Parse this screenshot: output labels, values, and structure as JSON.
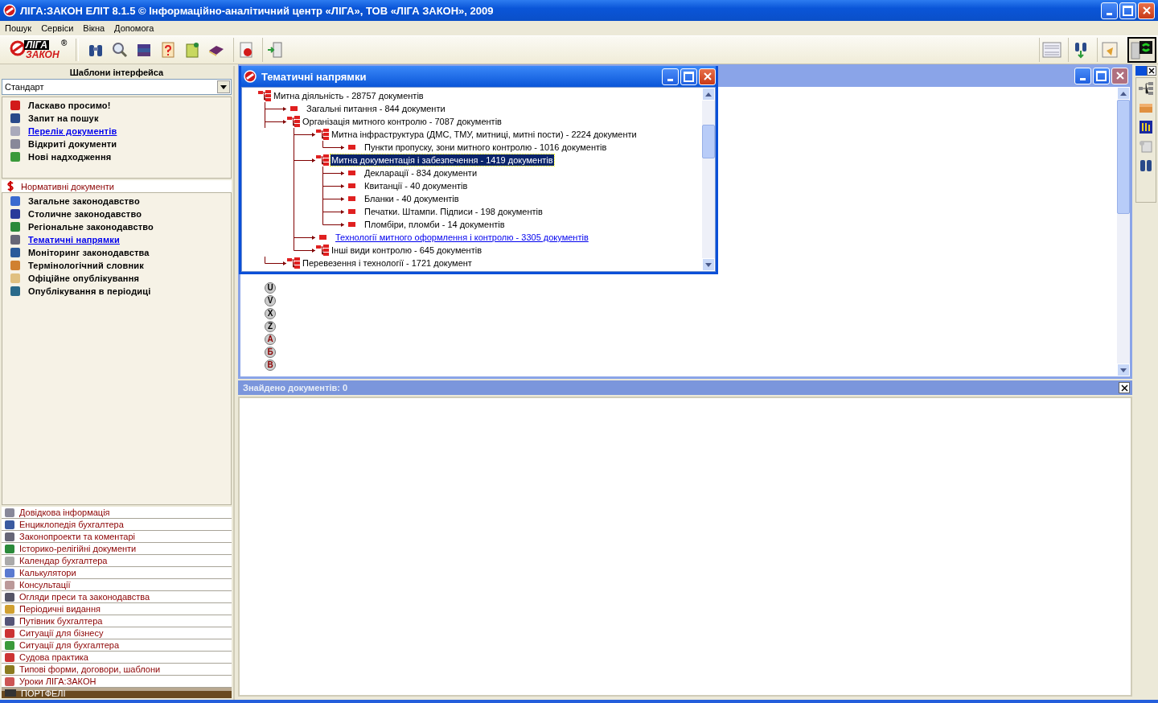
{
  "window": {
    "title": "ЛІГА:ЗАКОН ЕЛІТ 8.1.5 © Інформаційно-аналітичний центр «ЛІГА», ТОВ «ЛІГА ЗАКОН», 2009"
  },
  "menu": [
    "Пошук",
    "Сервіси",
    "Вікна",
    "Допомога"
  ],
  "logo": {
    "line_1": "ЛІГА",
    "line_2": "ЗАКОН",
    "mark": "®"
  },
  "sidebar": {
    "title": "Шаблони інтерфейса",
    "template": "Стандарт",
    "quick_items": [
      {
        "label": "Ласкаво просимо!",
        "link": false
      },
      {
        "label": "Запит на пошук",
        "link": false
      },
      {
        "label": "Перелік документів",
        "link": true
      },
      {
        "label": "Відкриті документи",
        "link": false
      },
      {
        "label": "Нові надходження",
        "link": false
      }
    ],
    "section": {
      "title": "Нормативні документи",
      "items": [
        {
          "label": "Загальне законодавство",
          "link": false
        },
        {
          "label": "Столичне законодавство",
          "link": false
        },
        {
          "label": "Регіональне законодавство",
          "link": false
        },
        {
          "label": "Тематичні напрямки",
          "link": true
        },
        {
          "label": "Моніторинг законодавства",
          "link": false
        },
        {
          "label": "Термінологічний словник",
          "link": false
        },
        {
          "label": "Офіційне опублікування",
          "link": false
        },
        {
          "label": "Опублікування в періодиці",
          "link": false
        }
      ]
    },
    "databases": [
      "Довідкова інформація",
      "Енциклопедія бухгалтера",
      "Законопроекти та коментарі",
      "Історико-релігійні документи",
      "Календар бухгалтера",
      "Калькулятори",
      "Консультації",
      "Огляди преси та законодавства",
      "Періодичні видання",
      "Путівник бухгалтера",
      "Ситуації для бізнесу",
      "Ситуації для бухгалтера",
      "Судова практика",
      "Типові форми, договори, шаблони",
      "Уроки ЛІГА:ЗАКОН"
    ],
    "portfolios": "ПОРТФЕЛІ"
  },
  "themes_window": {
    "title": "Тематичні напрямки",
    "tree": [
      {
        "label": "Митна діяльність - 28757 документів",
        "kind": "folder",
        "selected": false,
        "link": false,
        "children": [
          {
            "label": "Загальні питання - 844 документи",
            "kind": "leaf",
            "selected": false,
            "link": false
          },
          {
            "label": "Організація митного контролю - 7087 документів",
            "kind": "folder",
            "selected": false,
            "link": false,
            "children": [
              {
                "label": "Митна інфраструктура (ДМС, ТМУ, митниці, митні пости) - 2224 документи",
                "kind": "folder",
                "selected": false,
                "link": false,
                "children": [
                  {
                    "label": "Пункти пропуску, зони митного контролю - 1016 документів",
                    "kind": "leaf",
                    "selected": false,
                    "link": false
                  }
                ]
              },
              {
                "label": "Митна документація і забезпечення - 1419 документів",
                "kind": "folder",
                "selected": true,
                "link": false,
                "children": [
                  {
                    "label": "Декларації - 834 документи",
                    "kind": "leaf",
                    "selected": false,
                    "link": false
                  },
                  {
                    "label": "Квитанції - 40 документів",
                    "kind": "leaf",
                    "selected": false,
                    "link": false
                  },
                  {
                    "label": "Бланки - 40 документів",
                    "kind": "leaf",
                    "selected": false,
                    "link": false
                  },
                  {
                    "label": "Печатки. Штампи. Підписи - 198 документів",
                    "kind": "leaf",
                    "selected": false,
                    "link": false
                  },
                  {
                    "label": "Пломбіри, пломби - 14 документів",
                    "kind": "leaf",
                    "selected": false,
                    "link": false
                  }
                ]
              },
              {
                "label": "Технології митного оформлення і контролю - 3305 документів",
                "kind": "leaf",
                "selected": false,
                "link": true
              },
              {
                "label": "Інші види контролю - 645 документів",
                "kind": "folder",
                "selected": false,
                "link": false
              }
            ]
          },
          {
            "label": "Перевезення і технології - 1721 документ",
            "kind": "folder",
            "selected": false,
            "link": false
          }
        ]
      }
    ]
  },
  "index_letters": [
    {
      "letter": "U",
      "color": "#000000"
    },
    {
      "letter": "V",
      "color": "#000000"
    },
    {
      "letter": "X",
      "color": "#000000"
    },
    {
      "letter": "Z",
      "color": "#000000"
    },
    {
      "letter": "А",
      "color": "#8b0000"
    },
    {
      "letter": "Б",
      "color": "#8b0000"
    },
    {
      "letter": "В",
      "color": "#8b0000"
    }
  ],
  "results": {
    "title": "Знайдено документів: 0"
  }
}
